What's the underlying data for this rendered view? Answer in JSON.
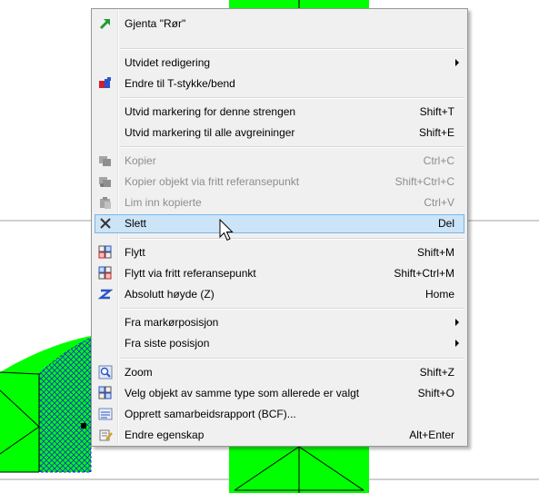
{
  "colors": {
    "canvas_green": "#00ff00",
    "hatch_blue": "#1a2fe0",
    "highlight_bg": "#cce4f7",
    "highlight_border": "#7ab4e6",
    "menu_bg": "#f0f0f0",
    "disabled_text": "#8d8d8d"
  },
  "menu": {
    "items": [
      {
        "label": "Gjenta \"Rør\"",
        "shortcut": "",
        "icon": "green-arrow-icon",
        "submenu": false,
        "disabled": false,
        "highlighted": false
      },
      {
        "label": "Utvidet redigering",
        "shortcut": "",
        "icon": "",
        "submenu": true,
        "disabled": false,
        "highlighted": false
      },
      {
        "label": "Endre til T-stykke/bend",
        "shortcut": "",
        "icon": "tee-pipe-icon",
        "submenu": false,
        "disabled": false,
        "highlighted": false
      },
      {
        "label": "Utvid markering for denne strengen",
        "shortcut": "Shift+T",
        "icon": "",
        "submenu": false,
        "disabled": false,
        "highlighted": false
      },
      {
        "label": "Utvid markering til alle avgreininger",
        "shortcut": "Shift+E",
        "icon": "",
        "submenu": false,
        "disabled": false,
        "highlighted": false
      },
      {
        "label": "Kopier",
        "shortcut": "Ctrl+C",
        "icon": "copy-icon",
        "submenu": false,
        "disabled": true,
        "highlighted": false
      },
      {
        "label": "Kopier objekt via fritt referansepunkt",
        "shortcut": "Shift+Ctrl+C",
        "icon": "copy-reference-icon",
        "submenu": false,
        "disabled": true,
        "highlighted": false
      },
      {
        "label": "Lim inn kopierte",
        "shortcut": "Ctrl+V",
        "icon": "paste-icon",
        "submenu": false,
        "disabled": true,
        "highlighted": false
      },
      {
        "label": "Slett",
        "shortcut": "Del",
        "icon": "delete-x-icon",
        "submenu": false,
        "disabled": false,
        "highlighted": true
      },
      {
        "label": "Flytt",
        "shortcut": "Shift+M",
        "icon": "move-icon",
        "submenu": false,
        "disabled": false,
        "highlighted": false
      },
      {
        "label": "Flytt via fritt referansepunkt",
        "shortcut": "Shift+Ctrl+M",
        "icon": "move-reference-icon",
        "submenu": false,
        "disabled": false,
        "highlighted": false
      },
      {
        "label": "Absolutt høyde (Z)",
        "shortcut": "Home",
        "icon": "z-height-icon",
        "submenu": false,
        "disabled": false,
        "highlighted": false
      },
      {
        "label": "Fra markørposisjon",
        "shortcut": "",
        "icon": "",
        "submenu": true,
        "disabled": false,
        "highlighted": false
      },
      {
        "label": "Fra siste posisjon",
        "shortcut": "",
        "icon": "",
        "submenu": true,
        "disabled": false,
        "highlighted": false
      },
      {
        "label": "Zoom",
        "shortcut": "Shift+Z",
        "icon": "zoom-icon",
        "submenu": false,
        "disabled": false,
        "highlighted": false
      },
      {
        "label": "Velg objekt av samme type som allerede er valgt",
        "shortcut": "Shift+O",
        "icon": "select-same-type-icon",
        "submenu": false,
        "disabled": false,
        "highlighted": false
      },
      {
        "label": "Opprett samarbeidsrapport (BCF)...",
        "shortcut": "",
        "icon": "bcf-report-icon",
        "submenu": false,
        "disabled": false,
        "highlighted": false
      },
      {
        "label": "Endre egenskap",
        "shortcut": "Alt+Enter",
        "icon": "edit-properties-icon",
        "submenu": false,
        "disabled": false,
        "highlighted": false
      }
    ]
  }
}
